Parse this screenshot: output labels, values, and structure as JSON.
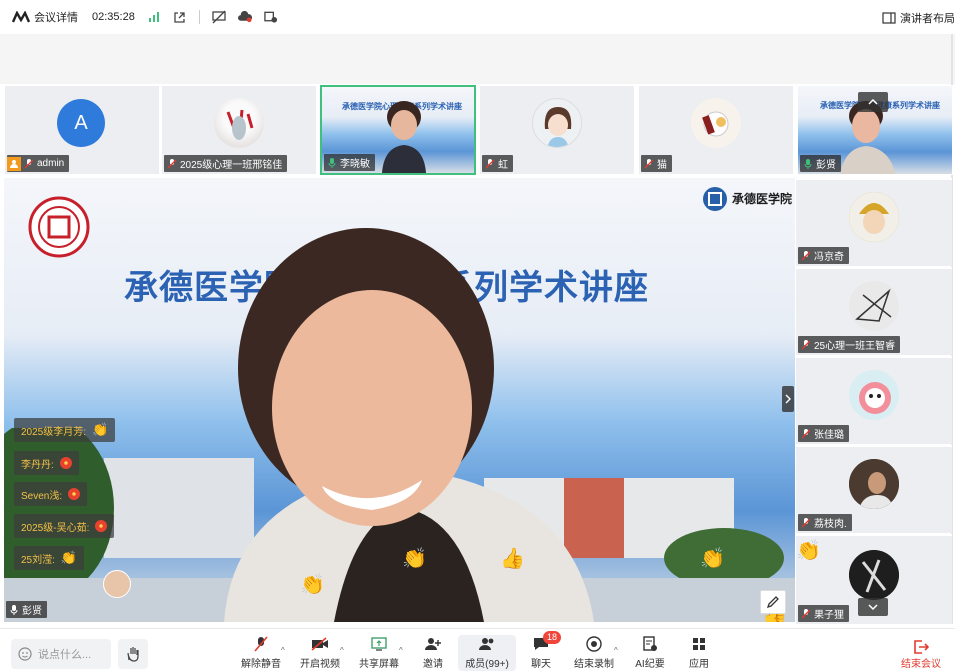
{
  "topbar": {
    "title": "会议详情",
    "duration": "02:35:28",
    "layout_label": "演讲者布局"
  },
  "strip_tiles": [
    {
      "name": "admin",
      "avatar_letter": "A",
      "is_host": true
    },
    {
      "name": "2025级心理一班邢铭佳"
    },
    {
      "name": "李晓敏",
      "active": true
    },
    {
      "name": "虹"
    },
    {
      "name": "猫"
    },
    {
      "name": "彭贤"
    }
  ],
  "slide": {
    "title": "承德医学院心理健康系列学术讲座",
    "school": "承德医学院"
  },
  "main_speaker": "彭贤",
  "chat_messages": [
    {
      "sender": "2025级李月芳:",
      "reaction": "clap"
    },
    {
      "sender": "李丹丹:",
      "reaction": "flower"
    },
    {
      "sender": "Seven浅:",
      "reaction": "flower"
    },
    {
      "sender": "2025级-吴心茹:",
      "reaction": "flower"
    },
    {
      "sender": "25刘滢:",
      "reaction": "clap"
    }
  ],
  "side_tiles": [
    {
      "name": "冯京奇"
    },
    {
      "name": "25心理一班王智睿"
    },
    {
      "name": "张佳璐"
    },
    {
      "name": "荔枝肉."
    },
    {
      "name": "果子狸"
    }
  ],
  "toolbar": {
    "input_placeholder": "说点什么...",
    "buttons": [
      {
        "label": "解除静音",
        "icon": "mic-off-icon"
      },
      {
        "label": "开启视频",
        "icon": "video-off-icon"
      },
      {
        "label": "共享屏幕",
        "icon": "share-screen-icon"
      },
      {
        "label": "邀请",
        "icon": "invite-icon"
      },
      {
        "label": "成员(99+)",
        "icon": "members-icon"
      },
      {
        "label": "聊天",
        "icon": "chat-icon",
        "badge": "18"
      },
      {
        "label": "结束录制",
        "icon": "record-icon"
      },
      {
        "label": "AI纪要",
        "icon": "ai-notes-icon"
      },
      {
        "label": "应用",
        "icon": "apps-icon"
      }
    ],
    "end_label": "结束会议"
  },
  "colors": {
    "active_border": "#3fc07c",
    "end_red": "#e33b2f",
    "slide_blue": "#2b62b3",
    "host_orange": "#f29a1e"
  }
}
